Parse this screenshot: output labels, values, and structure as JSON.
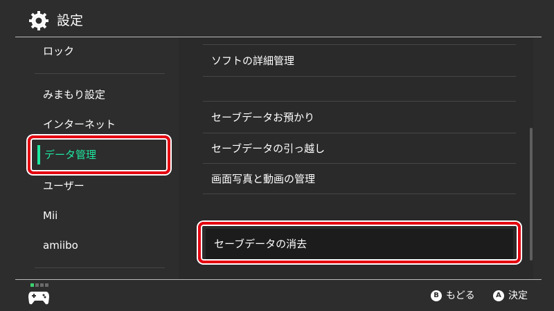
{
  "header": {
    "title": "設定",
    "icon": "gear-icon"
  },
  "sidebar": {
    "items": [
      {
        "label": "ロック"
      },
      {
        "label": "みまもり設定"
      },
      {
        "label": "インターネット"
      },
      {
        "label": "データ管理",
        "selected": true
      },
      {
        "label": "ユーザー"
      },
      {
        "label": "Mii"
      },
      {
        "label": "amiibo"
      }
    ]
  },
  "main": {
    "items": [
      {
        "label": "ソフトの詳細管理"
      },
      {
        "label": "セーブデータお預かり"
      },
      {
        "label": "セーブデータの引っ越し"
      },
      {
        "label": "画面写真と動画の管理"
      },
      {
        "label": "セーブデータの消去",
        "focused": true
      }
    ]
  },
  "footer": {
    "back": {
      "button": "B",
      "label": "もどる"
    },
    "ok": {
      "button": "A",
      "label": "決定"
    }
  },
  "colors": {
    "background": "#2d2d2d",
    "accent": "#1ee8a0",
    "highlight": "#e4000f",
    "player_indicator": "#3bd16f"
  }
}
